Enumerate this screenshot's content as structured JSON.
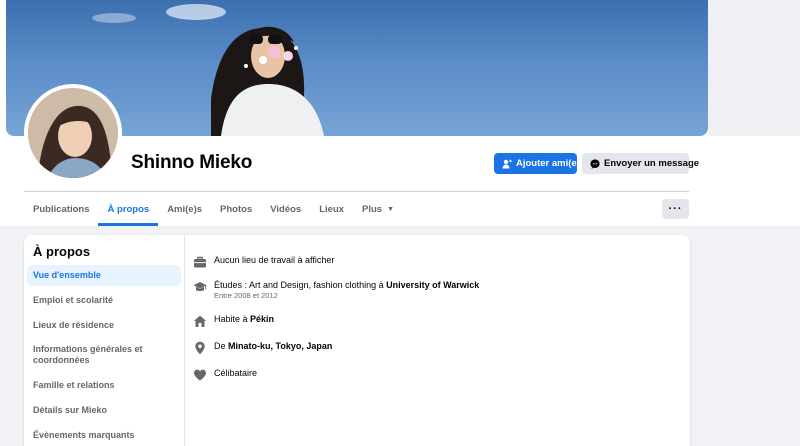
{
  "profile": {
    "name": "Shinno Mieko",
    "add_friend_label": "Ajouter ami(e)",
    "message_label": "Envoyer un message"
  },
  "tabs": [
    {
      "label": "Publications"
    },
    {
      "label": "À propos"
    },
    {
      "label": "Ami(e)s"
    },
    {
      "label": "Photos"
    },
    {
      "label": "Vidéos"
    },
    {
      "label": "Lieux"
    },
    {
      "label": "Plus"
    }
  ],
  "more_label": "···",
  "about": {
    "title": "À propos",
    "sections": [
      {
        "label": "Vue d'ensemble"
      },
      {
        "label": "Emploi et scolarité"
      },
      {
        "label": "Lieux de résidence"
      },
      {
        "label": "Informations générales et coordonnées"
      },
      {
        "label": "Famille et relations"
      },
      {
        "label": "Détails sur Mieko"
      },
      {
        "label": "Évènements marquants"
      }
    ],
    "work": {
      "text": "Aucun lieu de travail à afficher",
      "icon": "briefcase-icon"
    },
    "education": {
      "prefix": "Études : Art and Design, fashion clothing à ",
      "school": "University of Warwick",
      "dates": "Entre 2008 et 2012",
      "icon": "graduation-cap-icon"
    },
    "lives": {
      "prefix": "Habite à ",
      "city": "Pékin",
      "icon": "home-icon"
    },
    "from": {
      "prefix": "De ",
      "place": "Minato-ku, Tokyo, Japan",
      "icon": "location-pin-icon"
    },
    "relationship": {
      "text": "Célibataire",
      "icon": "heart-icon"
    }
  },
  "colors": {
    "accent": "#1b74e4",
    "muted": "#65676b",
    "background": "#f0f2f5"
  }
}
